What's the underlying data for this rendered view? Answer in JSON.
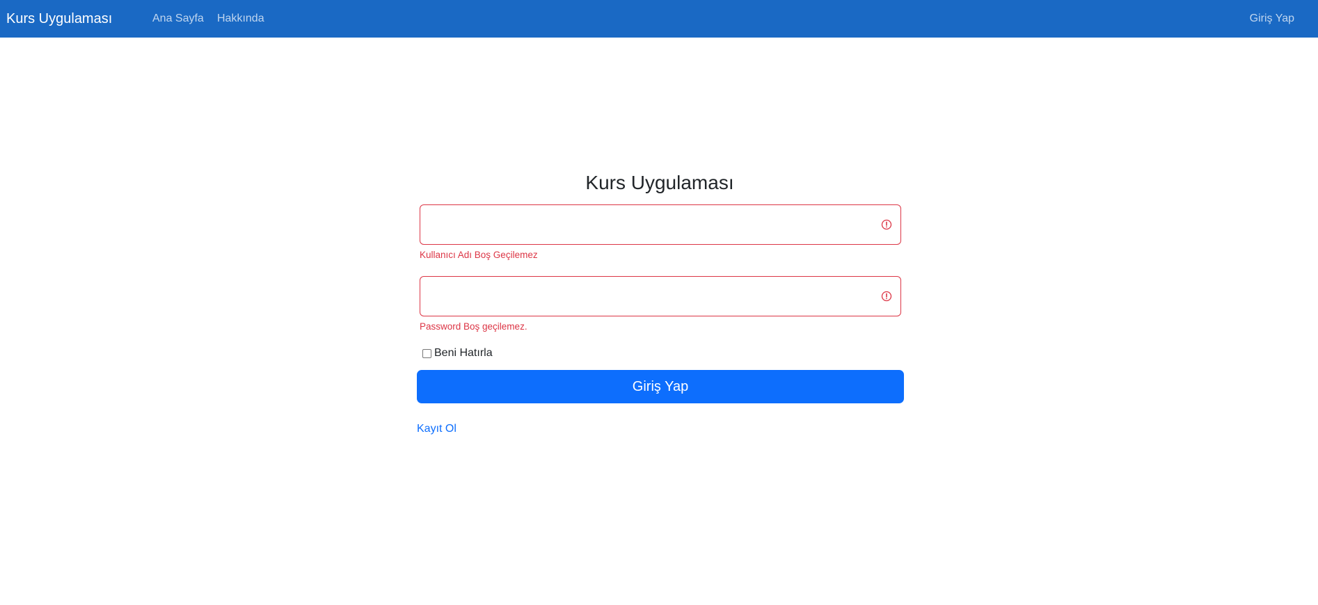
{
  "navbar": {
    "brand": "Kurs Uygulaması",
    "links": [
      {
        "label": "Ana Sayfa"
      },
      {
        "label": "Hakkında"
      }
    ],
    "login_label": "Giriş Yap"
  },
  "login_form": {
    "title": "Kurs Uygulaması",
    "username": {
      "value": "",
      "error": "Kullanıcı Adı Boş Geçilemez",
      "status_icon": "exclamation-circle-icon"
    },
    "password": {
      "value": "",
      "error": "Password Boş geçilemez.",
      "status_icon": "exclamation-circle-icon"
    },
    "remember_me": {
      "label": "Beni Hatırla",
      "checked": false
    },
    "submit_label": "Giriş Yap",
    "register_label": "Kayıt Ol"
  },
  "colors": {
    "navbar_bg": "#1a69c4",
    "primary": "#0d6efd",
    "danger": "#dc3545"
  }
}
